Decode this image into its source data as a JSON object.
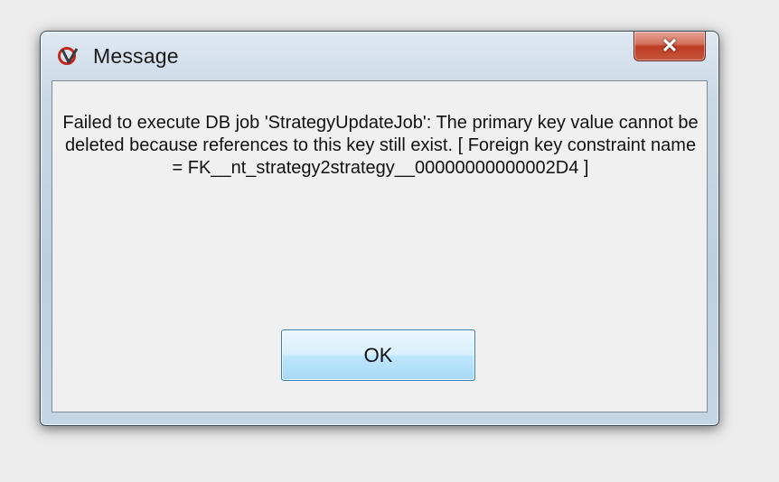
{
  "dialog": {
    "title": "Message",
    "icon": "app-logo-icon",
    "close_icon": "close-icon",
    "close_glyph": "✕",
    "message": "Failed to execute DB job 'StrategyUpdateJob': The primary key value cannot be deleted because references to this key still exist. [ Foreign key constraint name = FK__nt_strategy2strategy__00000000000002D4 ]",
    "ok_label": "OK"
  },
  "colors": {
    "desktop": "#ececec",
    "client_background": "#f0f0f0",
    "close_button": "#c7452d",
    "ok_button": "#bee6fd",
    "ok_border": "#3c7fb1",
    "logo_red": "#c4271b"
  }
}
